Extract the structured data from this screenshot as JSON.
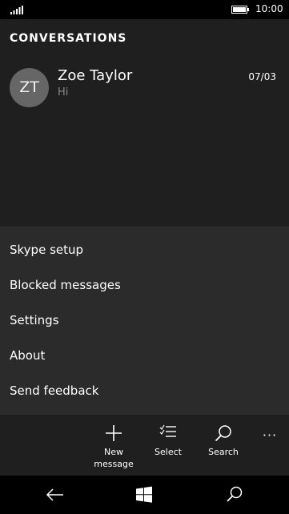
{
  "status_bar": {
    "time": "10:00",
    "signal_icon": "signal-icon",
    "battery_icon": "battery-icon"
  },
  "header": {
    "title": "CONVERSATIONS"
  },
  "conversations": [
    {
      "initials": "ZT",
      "name": "Zoe Taylor",
      "preview": "Hi",
      "date": "07/03"
    }
  ],
  "menu": {
    "items": [
      {
        "label": "Skype setup"
      },
      {
        "label": "Blocked messages"
      },
      {
        "label": "Settings"
      },
      {
        "label": "About"
      },
      {
        "label": "Send feedback"
      }
    ]
  },
  "app_bar": {
    "new_message_line1": "New",
    "new_message_line2": "message",
    "select": "Select",
    "search": "Search",
    "more": "···"
  },
  "nav_bar": {
    "icons": [
      "back-icon",
      "windows-icon",
      "search-icon"
    ]
  },
  "colors": {
    "background": "#1f1f1f",
    "menu_background": "#2b2b2b",
    "avatar": "#666666",
    "secondary_text": "#8a8a8a"
  }
}
